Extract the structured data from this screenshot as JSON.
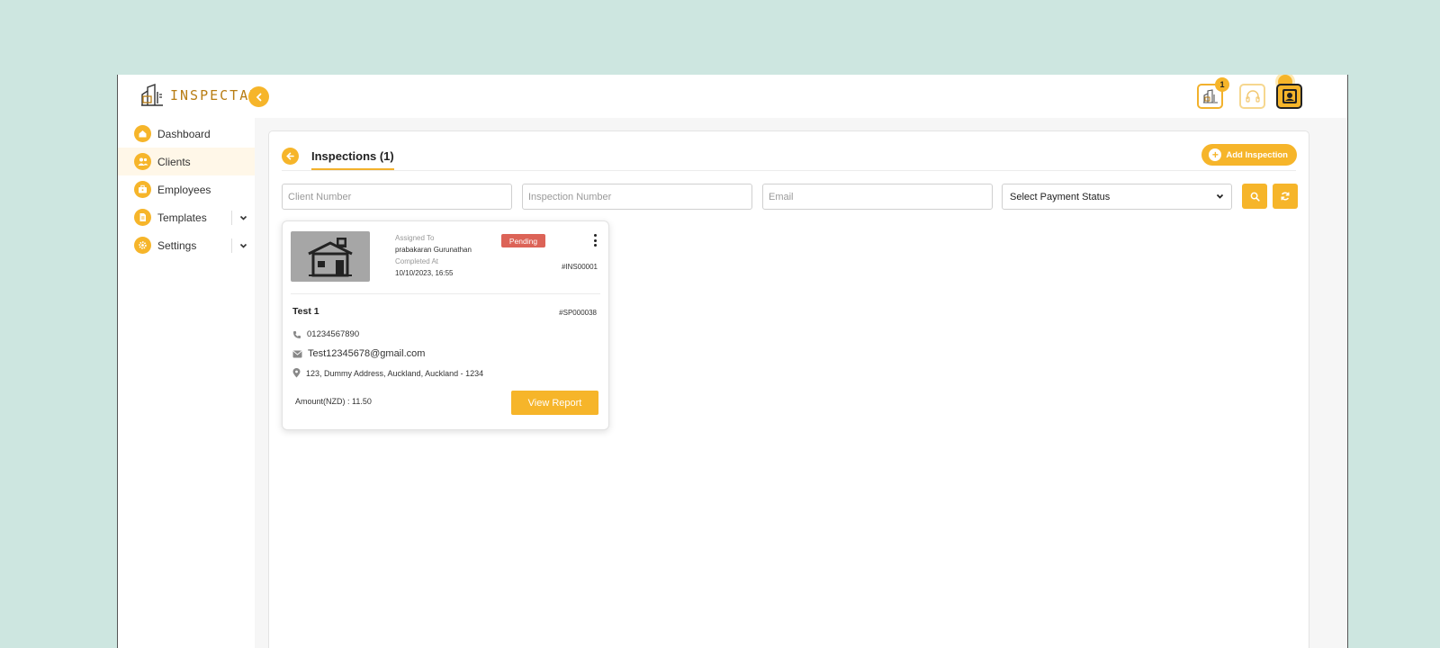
{
  "brand": {
    "name": "INSPECTAH"
  },
  "header": {
    "notification_count": "1"
  },
  "sidebar": {
    "items": [
      {
        "label": "Dashboard",
        "icon": "home-icon",
        "active": false,
        "expandable": false
      },
      {
        "label": "Clients",
        "icon": "users-icon",
        "active": true,
        "expandable": false
      },
      {
        "label": "Employees",
        "icon": "briefcase-icon",
        "active": false,
        "expandable": false
      },
      {
        "label": "Templates",
        "icon": "document-icon",
        "active": false,
        "expandable": true
      },
      {
        "label": "Settings",
        "icon": "gear-icon",
        "active": false,
        "expandable": true
      }
    ]
  },
  "page": {
    "title": "Inspections (1)",
    "add_button": "Add Inspection"
  },
  "filters": {
    "client_number_placeholder": "Client Number",
    "inspection_number_placeholder": "Inspection Number",
    "email_placeholder": "Email",
    "payment_status": "Select Payment Status"
  },
  "card": {
    "assigned_to_label": "Assigned To",
    "assigned_to": "prabakaran Gurunathan",
    "completed_at_label": "Completed At",
    "completed_at": "10/10/2023, 16:55",
    "status": "Pending",
    "inspection_id": "#INS00001",
    "client_name": "Test 1",
    "client_id": "#SP000038",
    "phone": "01234567890",
    "email": "Test12345678@gmail.com",
    "address": "123, Dummy Address, Auckland, Auckland - 1234",
    "amount_label": "Amount(NZD) :",
    "amount": "11.50",
    "view_report": "View Report"
  },
  "colors": {
    "accent": "#f6b52a",
    "pending": "#dc6357",
    "page_bg": "#cde6e0"
  }
}
